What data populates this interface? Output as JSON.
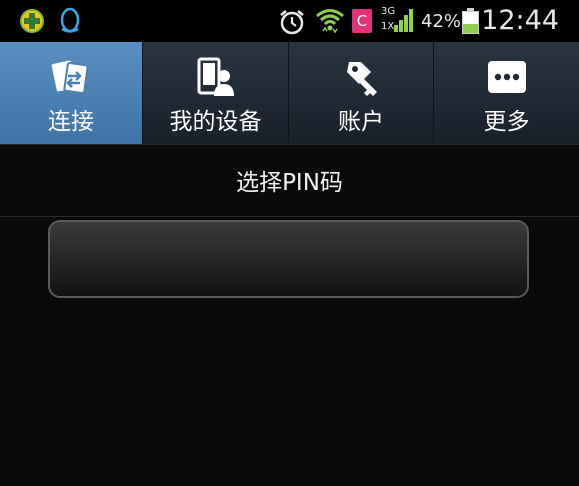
{
  "status_bar": {
    "time": "12:44",
    "battery_percent": "42%",
    "battery_level": 0.42,
    "network_type_top": "3G",
    "network_type_bottom": "1X",
    "carrier_badge": "C",
    "icons": [
      "app-360-icon",
      "qq-icon",
      "alarm-icon",
      "wifi-icon",
      "carrier-c-icon",
      "signal-icon",
      "battery-icon"
    ]
  },
  "tabs": [
    {
      "label": "连接",
      "icon": "connect-icon",
      "active": true
    },
    {
      "label": "我的设备",
      "icon": "my-devices-icon",
      "active": false
    },
    {
      "label": "账户",
      "icon": "account-key-icon",
      "active": false
    },
    {
      "label": "更多",
      "icon": "more-icon",
      "active": false
    }
  ],
  "section": {
    "title": "选择PIN码"
  },
  "pin_input": {
    "value": "",
    "placeholder": ""
  },
  "colors": {
    "active_tab": "#4a80b4",
    "tab_bar": "#1f2833",
    "background": "#0a0a0a",
    "battery_fill": "#8fd14f",
    "signal_green": "#8fd14f",
    "wifi_green": "#8fd14f",
    "carrier_pink": "#e0337a"
  }
}
